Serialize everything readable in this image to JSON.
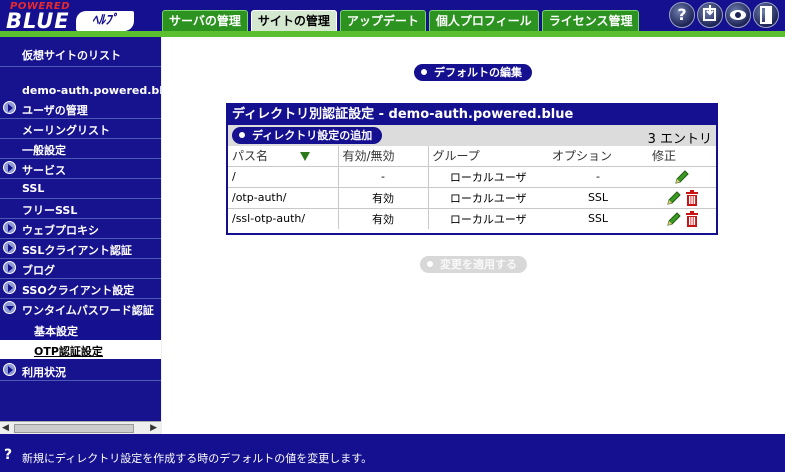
{
  "header": {
    "logo_powered": "POWERED",
    "logo_blue": "BLUE",
    "logo_version": "ﾍﾙﾌﾟ",
    "tabs": [
      {
        "label": "サーバの管理"
      },
      {
        "label": "サイトの管理"
      },
      {
        "label": "アップデート"
      },
      {
        "label": "個人プロフィール"
      },
      {
        "label": "ライセンス管理"
      }
    ],
    "icons": [
      "help-icon",
      "logout-icon",
      "preview-icon",
      "exit-icon"
    ]
  },
  "sidebar": {
    "site_list": "仮想サイトのリスト",
    "site_name": "demo-auth.powered.blue",
    "items": [
      {
        "label": "ユーザの管理"
      },
      {
        "label": "メーリングリスト"
      },
      {
        "label": "一般設定"
      },
      {
        "label": "サービス"
      },
      {
        "label": "SSL"
      },
      {
        "label": "フリーSSL"
      },
      {
        "label": "ウェブプロキシ"
      },
      {
        "label": "SSLクライアント認証"
      },
      {
        "label": "ブログ"
      },
      {
        "label": "SSOクライアント設定"
      },
      {
        "label": "ワンタイムパスワード認証"
      },
      {
        "label": "基本設定"
      },
      {
        "label": "OTP認証設定"
      },
      {
        "label": "利用状況"
      }
    ]
  },
  "main": {
    "edit_default_button": "デフォルトの編集",
    "panel_title": "ディレクトリ別認証設定 - demo-auth.powered.blue",
    "add_button": "ディレクトリ設定の追加",
    "entry_count": "3 エントリ",
    "columns": [
      "パス名",
      "有効/無効",
      "グループ",
      "オプション",
      "修正"
    ],
    "rows": [
      {
        "path": "/",
        "enabled": "-",
        "group": "ローカルユーザ",
        "option": "-"
      },
      {
        "path": "/otp-auth/",
        "enabled": "有効",
        "group": "ローカルユーザ",
        "option": "SSL"
      },
      {
        "path": "/ssl-otp-auth/",
        "enabled": "有効",
        "group": "ローカルユーザ",
        "option": "SSL"
      }
    ],
    "apply_button": "変更を適用する"
  },
  "footer": {
    "message": "新規にディレクトリ設定を作成する時のデフォルトの値を変更します。"
  }
}
